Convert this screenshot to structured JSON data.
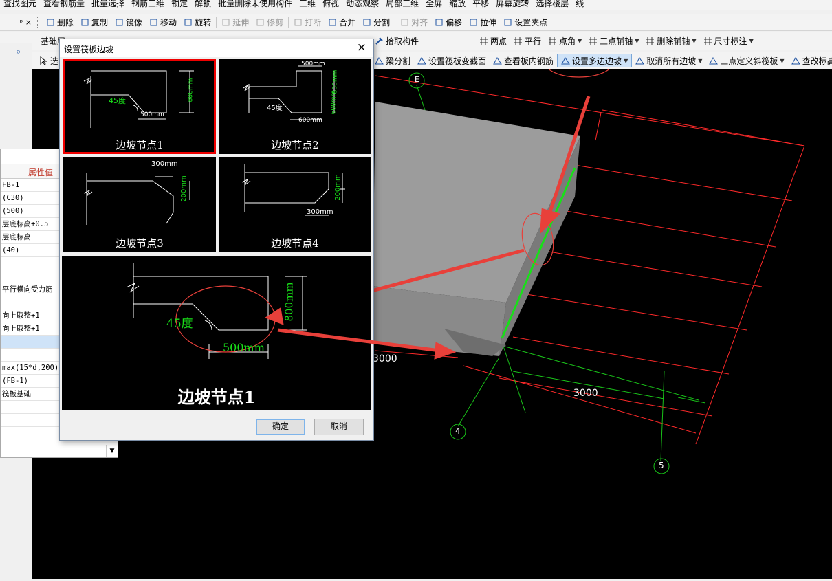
{
  "toolbar1": {
    "items": [
      "查找图元",
      "查看钢筋量",
      "批量选择",
      "钢筋三维",
      "锁定",
      "解锁",
      "批量删除未使用构件",
      "三维",
      "俯视",
      "动态观察",
      "局部三维",
      "全屏",
      "缩放",
      "平移",
      "屏幕旋转",
      "选择楼层",
      "线"
    ]
  },
  "toolbar2": {
    "pin": "ᵖ ×",
    "items": [
      {
        "label": "删除",
        "enabled": true
      },
      {
        "label": "复制",
        "enabled": true
      },
      {
        "label": "镜像",
        "enabled": true
      },
      {
        "label": "移动",
        "enabled": true
      },
      {
        "label": "旋转",
        "enabled": true
      },
      {
        "label": "延伸",
        "enabled": false
      },
      {
        "label": "修剪",
        "enabled": false
      },
      {
        "label": "打断",
        "enabled": false
      },
      {
        "label": "合并",
        "enabled": true
      },
      {
        "label": "分割",
        "enabled": true
      },
      {
        "label": "对齐",
        "enabled": false
      },
      {
        "label": "偏移",
        "enabled": true
      },
      {
        "label": "拉伸",
        "enabled": true
      },
      {
        "label": "设置夹点",
        "enabled": true
      }
    ]
  },
  "toolbar3": {
    "left": "基础层",
    "pick": "拾取构件",
    "right": [
      "两点",
      "平行",
      "点角",
      "三点辅轴",
      "删除辅轴",
      "尺寸标注"
    ]
  },
  "toolbar4": {
    "items": [
      "梁分割",
      "设置筏板变截面",
      "查看板内钢筋",
      "设置多边边坡",
      "取消所有边坡",
      "三点定义斜筏板",
      "查改标高"
    ],
    "active": "设置多边边坡",
    "left": "选"
  },
  "properties": {
    "header": "属性值",
    "rows": [
      "FB-1",
      "(C30)",
      "(500)",
      "层底标高+0.5",
      "层底标高",
      "(40)",
      "",
      "",
      "平行横向受力筋",
      "",
      "向上取整+1",
      "向上取整+1",
      "",
      "",
      "max(15*d,200)",
      "(FB-1)",
      "筏板基础",
      "",
      ""
    ]
  },
  "dialog": {
    "title": "设置筏板边坡",
    "close": "×",
    "thumbnails": [
      {
        "label": "边坡节点1",
        "selected": true,
        "texts": [
          "45度",
          "500mm",
          "800mm"
        ]
      },
      {
        "label": "边坡节点2",
        "selected": false,
        "texts": [
          "500mm",
          "800mm",
          "45度",
          "600mm",
          "600mm"
        ]
      },
      {
        "label": "边坡节点3",
        "selected": false,
        "texts": [
          "300mm",
          "200mm"
        ]
      },
      {
        "label": "边坡节点4",
        "selected": false,
        "texts": [
          "300mm",
          "200mm"
        ]
      }
    ],
    "preview": {
      "label": "边坡节点1",
      "angle": "45度",
      "width": "500mm",
      "height": "800mm"
    },
    "ok": "确定",
    "cancel": "取消"
  },
  "scene": {
    "axis_labels": [
      "E",
      "4",
      "5"
    ],
    "dims": [
      "3000",
      "3000"
    ]
  },
  "colors": {
    "accent_red": "#e8403a",
    "grid_red": "#ff2a2a",
    "green": "#18e018"
  }
}
